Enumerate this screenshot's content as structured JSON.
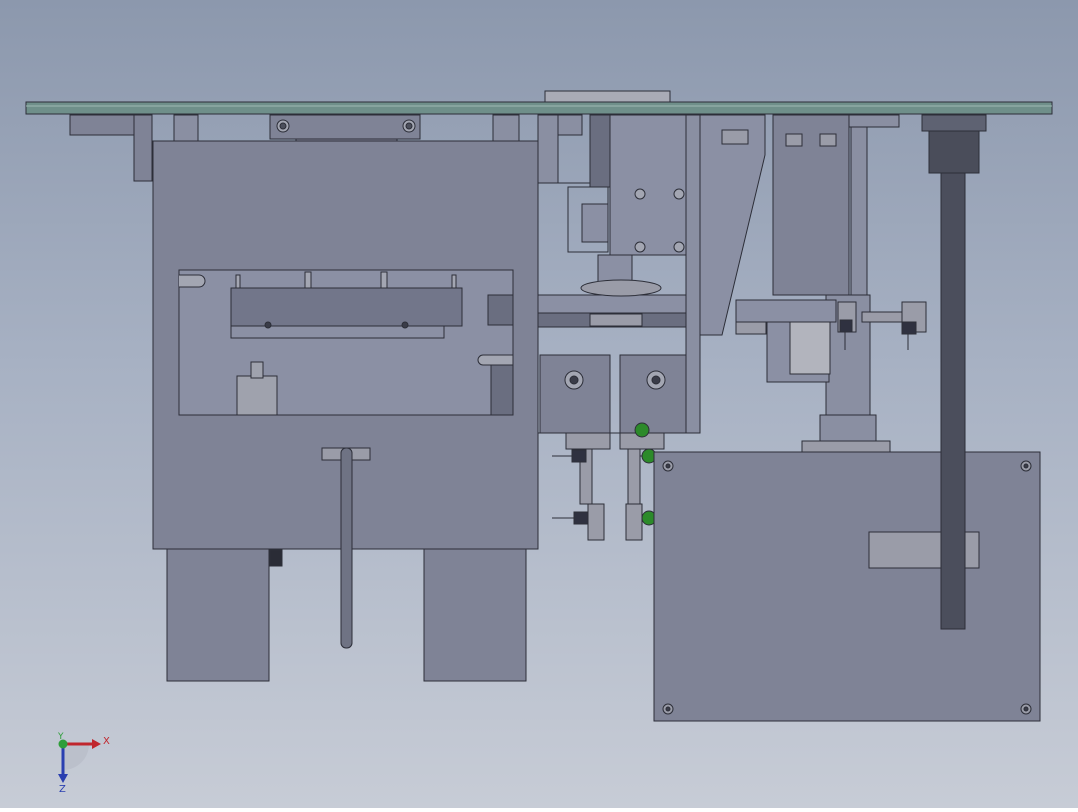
{
  "triad": {
    "x_label": "X",
    "y_label": "Y",
    "z_label": "Z",
    "x_color": "#c0262d",
    "y_color": "#2e9e3a",
    "z_color": "#2a3fb0"
  },
  "colors": {
    "background_top": "#8c98ad",
    "background_bottom": "#c7ccd6",
    "body_fill": "#7f8396",
    "body_dark": "#6a6e80",
    "edge": "#2c2e38",
    "plate_fill": "#6f8f8a",
    "fitting_green": "#2c8a2a",
    "label_plate": "#9a9ca8"
  }
}
